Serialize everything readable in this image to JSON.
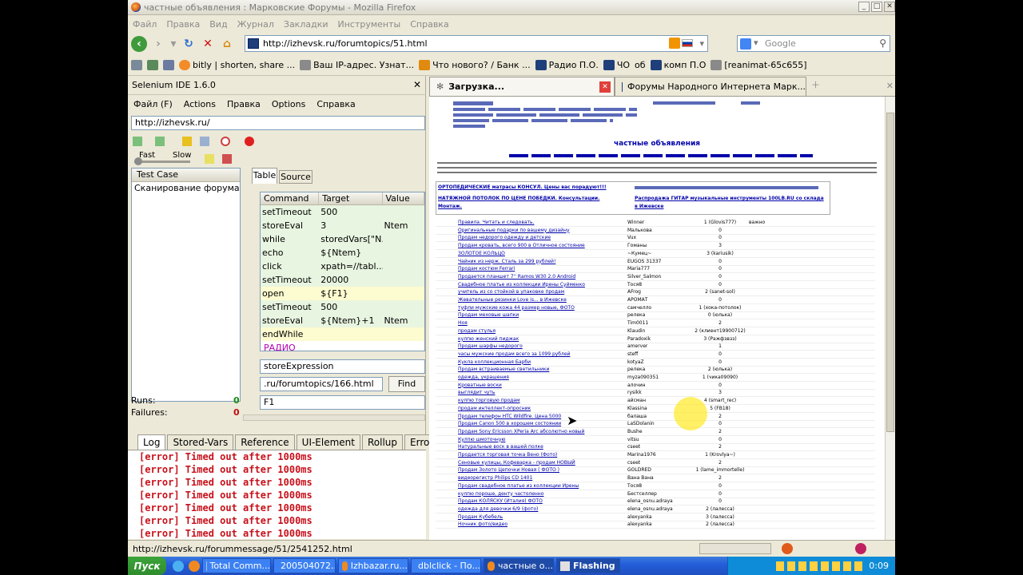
{
  "window": {
    "title": "частные объявления : Марковские Форумы - Mozilla Firefox"
  },
  "menubar": [
    "Файл",
    "Правка",
    "Вид",
    "Журнал",
    "Закладки",
    "Инструменты",
    "Справка"
  ],
  "navbar": {
    "url": "http://izhevsk.ru/forumtopics/51.html",
    "search_placeholder": "Google"
  },
  "bookmarks": [
    "bitly | shorten, share ...",
    "Ваш IP-адрес. Узнат...",
    "Что нового? / Банк ...",
    "Радио П.О.",
    "ЧО",
    "об",
    "комп П.О",
    "[reanimat-65c655]"
  ],
  "selenium": {
    "title": "Selenium IDE 1.6.0",
    "menu": [
      "Файл (F)",
      "Actions",
      "Правка",
      "Options",
      "Справка"
    ],
    "base_url": "http://izhevsk.ru/",
    "speed_fast": "Fast",
    "speed_slow": "Slow",
    "testcase_header": "Test Case",
    "testcase_item": "Сканирование форума 2...",
    "tab_table": "Table",
    "tab_source": "Source",
    "col_command": "Command",
    "col_target": "Target",
    "col_value": "Value",
    "rows": [
      {
        "cmd": "setTimeout",
        "target": "500",
        "value": ""
      },
      {
        "cmd": "storeEval",
        "target": "3",
        "value": "Ntem"
      },
      {
        "cmd": "while",
        "target": "storedVars[\"N...",
        "value": ""
      },
      {
        "cmd": "echo",
        "target": "${Ntem}",
        "value": ""
      },
      {
        "cmd": "click",
        "target": "xpath=//tabl...",
        "value": ""
      },
      {
        "cmd": "setTimeout",
        "target": "20000",
        "value": ""
      },
      {
        "cmd": "open",
        "target": "${F1}",
        "value": ""
      },
      {
        "cmd": "setTimeout",
        "target": "500",
        "value": ""
      },
      {
        "cmd": "storeEval",
        "target": "${Ntem}+1",
        "value": "Ntem"
      },
      {
        "cmd": "endWhile",
        "target": "",
        "value": ""
      },
      {
        "cmd": "РАДИО",
        "target": "",
        "value": ""
      }
    ],
    "command_field": "storeExpression",
    "target_field": ".ru/forumtopics/166.html",
    "find_label": "Find",
    "value_field": "F1",
    "runs_label": "Runs:",
    "runs_value": "0",
    "failures_label": "Failures:",
    "failures_value": "0",
    "log_tabs": [
      "Log",
      "Stored-Vars",
      "Reference",
      "UI-Element",
      "Rollup",
      "Error"
    ],
    "log_lines": [
      "[error] Timed out after 1000ms",
      "[error] Timed out after 1000ms",
      "[error] Timed out after 1000ms",
      "[error] Timed out after 1000ms",
      "[error] Timed out after 1000ms",
      "[error] Timed out after 1000ms",
      "[error] Timed out after 1000ms"
    ]
  },
  "browser_tabs": [
    "Загрузка...",
    "Форумы Народного Интернета Марк..."
  ],
  "forum": {
    "heading": "частные объявления",
    "notice1": "ОРТОПЕДИЧЕСКИЕ матрасы КОНСУЛ. Цены вас порадуют!!!",
    "notice2": "НАТЯЖНОЙ ПОТОЛОК ПО ЦЕНЕ ПОБЕДКИ. Консультации. Монтаж.",
    "notice3": "Распродажа ГИТАР музыкальные инструменты 100LB.RU со склада в Ижевске",
    "rows": [
      [
        "Правила. Читать и следовать.",
        "Winner",
        "1 (Glovis777)",
        "важно"
      ],
      [
        "Оригинальные подарки по вашему дизайну",
        "Малькова",
        "0",
        ""
      ],
      [
        "Продам недорого одежду и детские",
        "Vux",
        "0",
        ""
      ],
      [
        "Продам кровать, всего 900 в Отличное состояние",
        "Гоманы",
        "3",
        ""
      ],
      [
        "ЗОЛОТОЕ КОЛЬЦО",
        "~Кумец~",
        "3 (kariusik)",
        ""
      ],
      [
        "Чайник из нерж. Сталь за 299 рублей!",
        "EUGOS 31337",
        "0",
        ""
      ],
      [
        "Продам костюм Ferrari",
        "Maria777",
        "0",
        ""
      ],
      [
        "Продается планшет 7'' Ramos W30 2.0 Android",
        "Silver_Salmon",
        "0",
        ""
      ],
      [
        "Свадебное платье из коллекции Ирены Суйменко",
        "Тося8",
        "0",
        ""
      ],
      [
        "учитель из со стойкой в упаковке продам",
        "AFrog",
        "2 (sanet-sol)",
        ""
      ],
      [
        "Жевательные резинки Love is... в Ижевске",
        "АРОМАТ",
        "0",
        ""
      ],
      [
        "туфли мужские кожа 44 размер новые, ФОТО",
        "самчелло",
        "1 (хока-потолок)",
        ""
      ],
      [
        "Продам меховые шапки",
        "релека",
        "0 (юлька)",
        ""
      ],
      [
        "Ноя",
        "Tim0011",
        "2",
        ""
      ],
      [
        "продам стулья",
        "Klaudin",
        "2 (клиент19900712)",
        ""
      ],
      [
        "кулпю женский пиджак",
        "Paradoxik",
        "3 (Ражфзвзз)",
        ""
      ],
      [
        "Продам шарфы недорого",
        "amerver",
        "1",
        ""
      ],
      [
        "часы мужские продам всего за 1099 рублей",
        "steff",
        "0",
        ""
      ],
      [
        "Кукла коллекционная Барби",
        "kotyaZ",
        "0",
        ""
      ],
      [
        "Продам встраиваемые светильники",
        "релека",
        "2 (юлька)",
        ""
      ],
      [
        "одежда, украшения",
        "myza090351",
        "1 (чика09090)",
        ""
      ],
      [
        "Кроватные воски",
        "алочин",
        "0",
        ""
      ],
      [
        "выглядит чуть",
        "rysikk",
        "3",
        ""
      ],
      [
        "кулпю торговую продам",
        "айсман",
        "4 (smart_rec)",
        ""
      ],
      [
        "продам интеллект-опросник",
        "Klassina",
        "5 (FB18)",
        ""
      ],
      [
        "Продам телефон HTC Wildfire. Цена 5000",
        "балаша",
        "2",
        ""
      ],
      [
        "Продам Canon 500 в хорошем состоянии",
        "LaSDolanin",
        "0",
        ""
      ],
      [
        "Продам Sony Ericsson XPeria Arc абсолютно новый",
        "Bushe",
        "2",
        ""
      ],
      [
        "Кулпю шмоточную",
        "vitsu",
        "0",
        ""
      ],
      [
        "Натуральные воск в вашей полке",
        "cseet",
        "2",
        ""
      ],
      [
        "Продается торговая точка Вено (Фото)",
        "Marina1976",
        "1 (Krovlya~)",
        ""
      ],
      [
        "Сеновые кулицы, Кофеварка - продам НОВЫЙ",
        "cseet",
        "2",
        ""
      ],
      [
        "Продам Золото Цепочки Новая ( ФОТО )",
        "GOLDRED",
        "1 (lame_immortelle)",
        ""
      ],
      [
        "видеорегистр Philips CD 1401",
        "Вана Вана",
        "2",
        ""
      ],
      [
        "Продам свадебное платье из коллекции Ирены",
        "Тося8",
        "0",
        ""
      ],
      [
        "кулпю пороше, денту частоленно",
        "Бестселлер",
        "0",
        ""
      ],
      [
        "Продам КОЛЯСКУ (Италия) ФОТО",
        "elena_osnu.adraya",
        "0",
        ""
      ],
      [
        "одежда для девочки 6/9 (фото)",
        "elena_osnu.adraya",
        "2 (лалесса)",
        ""
      ],
      [
        "Продам Кубебель",
        "alexyanka",
        "3 (лалесса)",
        ""
      ],
      [
        "Ночник фото/видео",
        "alexyanka",
        "2 (лалесса)",
        ""
      ]
    ]
  },
  "status_text": "http://izhevsk.ru/forummessage/51/2541252.html",
  "taskbar": {
    "start": "Пуск",
    "tasks": [
      "Total Comm...",
      "200504072...",
      "Izhbazar.ru...",
      "dblclick - По...",
      "частные о...",
      "Flashing"
    ],
    "clock": "0:09"
  }
}
